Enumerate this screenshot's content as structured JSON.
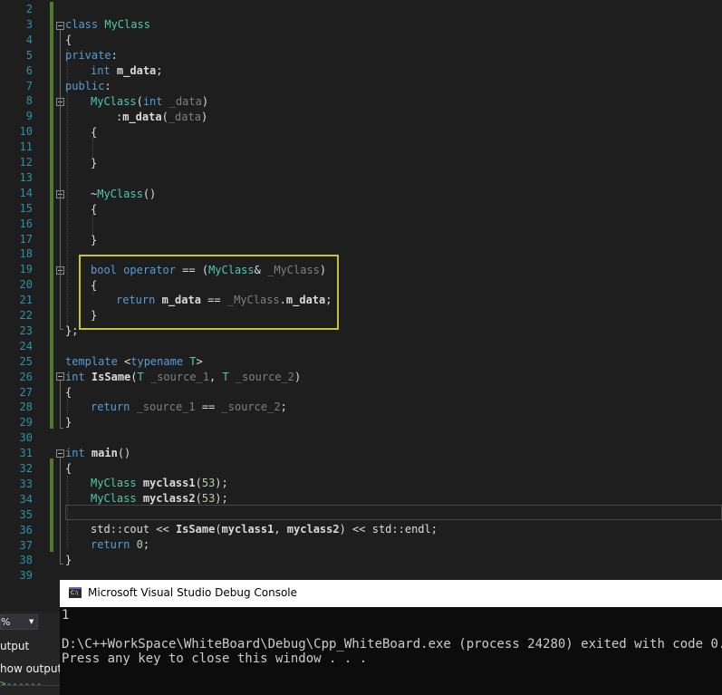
{
  "editor": {
    "line_numbers": [
      "2",
      "3",
      "4",
      "5",
      "6",
      "7",
      "8",
      "9",
      "10",
      "11",
      "12",
      "13",
      "14",
      "15",
      "16",
      "17",
      "18",
      "19",
      "20",
      "21",
      "22",
      "23",
      "24",
      "25",
      "26",
      "27",
      "28",
      "29",
      "30",
      "31",
      "32",
      "33",
      "34",
      "35",
      "36",
      "37",
      "38",
      "39"
    ],
    "code": {
      "l3_kw": "class",
      "l3_name": "MyClass",
      "l4": "{",
      "l5_kw": "private",
      "l6_kw": "int",
      "l6_member": "m_data",
      "l7_kw": "public",
      "l8_name": "MyClass",
      "l8_kw": "int",
      "l8_param": "_data",
      "l9_member": "m_data",
      "l9_param": "_data",
      "l10": "{",
      "l12": "}",
      "l14_name": "MyClass",
      "l15": "{",
      "l17": "}",
      "l19_kw": "bool",
      "l19_kw2": "operator",
      "l19_type": "MyClass",
      "l19_param": "_MyClass",
      "l20": "{",
      "l21_kw": "return",
      "l21_member": "m_data",
      "l21_param": "_MyClass",
      "l21_member2": "m_data",
      "l22": "}",
      "l23": "};",
      "l25_kw": "template",
      "l25_kw2": "typename",
      "l25_type": "T",
      "l26_kw": "int",
      "l26_name": "IsSame",
      "l26_type1": "T",
      "l26_param1": "_source_1",
      "l26_type2": "T",
      "l26_param2": "_source_2",
      "l27": "{",
      "l28_kw": "return",
      "l28_param1": "_source_1",
      "l28_param2": "_source_2",
      "l29": "}",
      "l31_kw": "int",
      "l31_name": "main",
      "l32": "{",
      "l33_type": "MyClass",
      "l33_var": "myclass1",
      "l33_num": "53",
      "l34_type": "MyClass",
      "l34_var": "myclass2",
      "l34_num": "53",
      "l36_ns1": "std",
      "l36_cout": "cout",
      "l36_func": "IsSame",
      "l36_arg1": "myclass1",
      "l36_arg2": "myclass2",
      "l36_ns2": "std",
      "l36_endl": "endl",
      "l37_kw": "return",
      "l37_num": "0",
      "l38": "}"
    }
  },
  "console": {
    "icon_label": "C:\\",
    "title": "Microsoft Visual Studio Debug Console",
    "output_line1": "1",
    "output_line2": "D:\\C++WorkSpace\\WhiteBoard\\Debug\\Cpp_WhiteBoard.exe (process 24280) exited with code 0.",
    "output_line3": "Press any key to close this window . . ."
  },
  "output_panel": {
    "zoom": "%",
    "title_fragment": "utput",
    "show_output_fragment": "how output f",
    "arrow_fragment": ">------"
  },
  "colors": {
    "keyword": "#569cd6",
    "type": "#4ec9b0",
    "parameter": "#7f7f7f",
    "number": "#b5cea8",
    "line_number": "#2b91af",
    "highlight_box": "#c8c23a",
    "change_bar": "#4e7a2a"
  }
}
